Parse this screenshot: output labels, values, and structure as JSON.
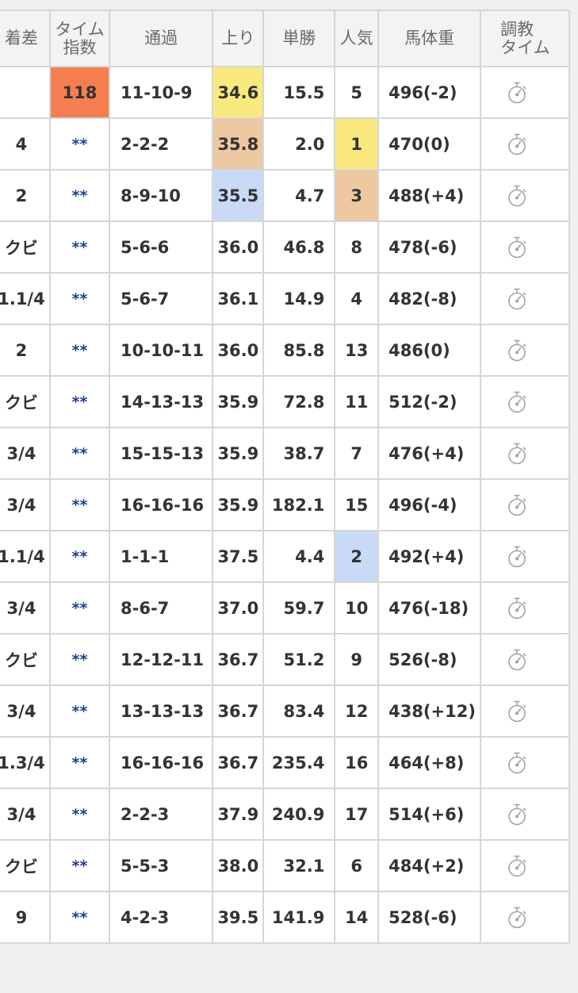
{
  "headers": {
    "diff": "着差",
    "time_index_line1": "タイム",
    "time_index_line2": "指数",
    "passing": "通過",
    "agari": "上り",
    "win_odds": "単勝",
    "popularity": "人気",
    "body_weight": "馬体重",
    "training_line1": "調教",
    "training_line2": "タイム"
  },
  "rows": [
    {
      "diff": "",
      "time_index": "118",
      "passing": "11-10-9",
      "agari": "34.6",
      "win_odds": "15.5",
      "popularity": "5",
      "body_weight": "496(-2)"
    },
    {
      "diff": "4",
      "time_index": "**",
      "passing": "2-2-2",
      "agari": "35.8",
      "win_odds": "2.0",
      "popularity": "1",
      "body_weight": "470(0)"
    },
    {
      "diff": "2",
      "time_index": "**",
      "passing": "8-9-10",
      "agari": "35.5",
      "win_odds": "4.7",
      "popularity": "3",
      "body_weight": "488(+4)"
    },
    {
      "diff": "クビ",
      "time_index": "**",
      "passing": "5-6-6",
      "agari": "36.0",
      "win_odds": "46.8",
      "popularity": "8",
      "body_weight": "478(-6)"
    },
    {
      "diff": "1.1/4",
      "time_index": "**",
      "passing": "5-6-7",
      "agari": "36.1",
      "win_odds": "14.9",
      "popularity": "4",
      "body_weight": "482(-8)"
    },
    {
      "diff": "2",
      "time_index": "**",
      "passing": "10-10-11",
      "agari": "36.0",
      "win_odds": "85.8",
      "popularity": "13",
      "body_weight": "486(0)"
    },
    {
      "diff": "クビ",
      "time_index": "**",
      "passing": "14-13-13",
      "agari": "35.9",
      "win_odds": "72.8",
      "popularity": "11",
      "body_weight": "512(-2)"
    },
    {
      "diff": "3/4",
      "time_index": "**",
      "passing": "15-15-13",
      "agari": "35.9",
      "win_odds": "38.7",
      "popularity": "7",
      "body_weight": "476(+4)"
    },
    {
      "diff": "3/4",
      "time_index": "**",
      "passing": "16-16-16",
      "agari": "35.9",
      "win_odds": "182.1",
      "popularity": "15",
      "body_weight": "496(-4)"
    },
    {
      "diff": "1.1/4",
      "time_index": "**",
      "passing": "1-1-1",
      "agari": "37.5",
      "win_odds": "4.4",
      "popularity": "2",
      "body_weight": "492(+4)"
    },
    {
      "diff": "3/4",
      "time_index": "**",
      "passing": "8-6-7",
      "agari": "37.0",
      "win_odds": "59.7",
      "popularity": "10",
      "body_weight": "476(-18)"
    },
    {
      "diff": "クビ",
      "time_index": "**",
      "passing": "12-12-11",
      "agari": "36.7",
      "win_odds": "51.2",
      "popularity": "9",
      "body_weight": "526(-8)"
    },
    {
      "diff": "3/4",
      "time_index": "**",
      "passing": "13-13-13",
      "agari": "36.7",
      "win_odds": "83.4",
      "popularity": "12",
      "body_weight": "438(+12)"
    },
    {
      "diff": "1.3/4",
      "time_index": "**",
      "passing": "16-16-16",
      "agari": "36.7",
      "win_odds": "235.4",
      "popularity": "16",
      "body_weight": "464(+8)"
    },
    {
      "diff": "3/4",
      "time_index": "**",
      "passing": "2-2-3",
      "agari": "37.9",
      "win_odds": "240.9",
      "popularity": "17",
      "body_weight": "514(+6)"
    },
    {
      "diff": "クビ",
      "time_index": "**",
      "passing": "5-5-3",
      "agari": "38.0",
      "win_odds": "32.1",
      "popularity": "6",
      "body_weight": "484(+2)"
    },
    {
      "diff": "9",
      "time_index": "**",
      "passing": "4-2-3",
      "agari": "39.5",
      "win_odds": "141.9",
      "popularity": "14",
      "body_weight": "528(-6)"
    }
  ],
  "training_icon": "stopwatch-icon",
  "colors": {
    "time_index_top": "#f57f50",
    "rank_1": "#fae97f",
    "rank_2": "#c8daf5",
    "rank_3": "#edc8a1",
    "time_index_text": "#1d3f8f"
  },
  "highlights": {
    "agari": {
      "0": "hl-1",
      "1": "hl-3",
      "2": "hl-2"
    },
    "popularity": {
      "1": "hl-1",
      "2": "hl-3",
      "9": "hl-2"
    },
    "time_index": {
      "0": "hl-ti"
    }
  }
}
